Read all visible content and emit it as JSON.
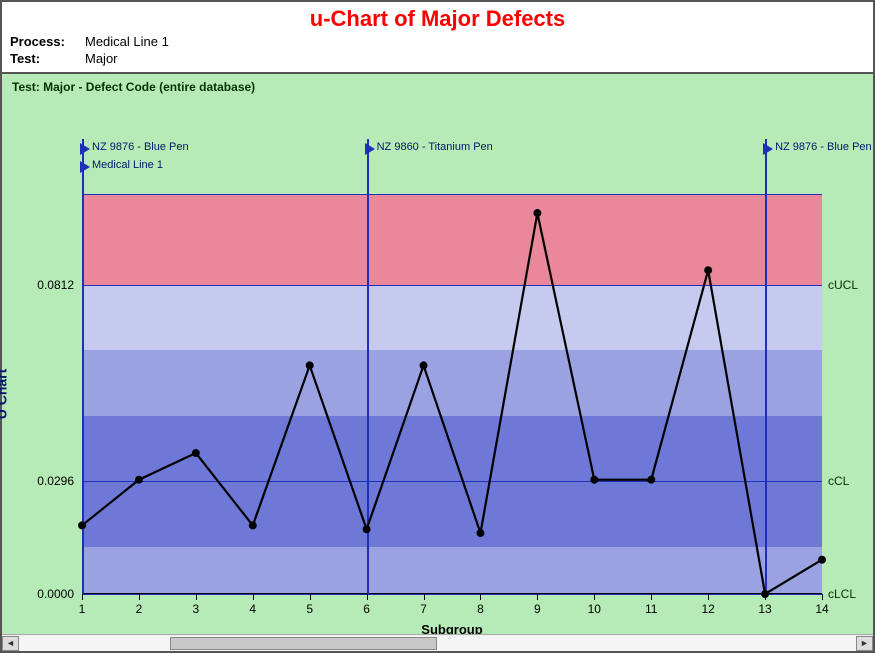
{
  "header": {
    "title": "u-Chart of Major Defects",
    "process_label": "Process:",
    "process_value": "Medical Line 1",
    "test_label": "Test:",
    "test_value": "Major"
  },
  "chart_subtitle": "Test: Major - Defect Code (entire database)",
  "y_axis_label": "U Chart",
  "x_axis_label": "Subgroup",
  "y_ticks": [
    {
      "v": 0.0,
      "label": "0.0000"
    },
    {
      "v": 0.0296,
      "label": "0.0296"
    },
    {
      "v": 0.0812,
      "label": "0.0812"
    }
  ],
  "control_lines": [
    {
      "v": 0.0,
      "label": "cLCL"
    },
    {
      "v": 0.0296,
      "label": "cCL"
    },
    {
      "v": 0.0812,
      "label": "cUCL"
    }
  ],
  "chart_data": {
    "type": "line",
    "title": "u-Chart of Major Defects",
    "xlabel": "Subgroup",
    "ylabel": "U Chart",
    "ylim": [
      0.0,
      0.105
    ],
    "xlim": [
      1,
      14
    ],
    "categories": [
      1,
      2,
      3,
      4,
      5,
      6,
      7,
      8,
      9,
      10,
      11,
      12,
      13,
      14
    ],
    "values": [
      0.018,
      0.03,
      0.037,
      0.018,
      0.06,
      0.017,
      0.06,
      0.016,
      0.1,
      0.03,
      0.03,
      0.085,
      0.0,
      0.009
    ],
    "ucl": 0.0812,
    "cl": 0.0296,
    "lcl": 0.0,
    "zone_top": 0.105,
    "sigma_width": 0.0172
  },
  "event_markers": [
    {
      "x": 1,
      "labels": [
        "NZ 9876 - Blue Pen",
        "Medical Line 1"
      ]
    },
    {
      "x": 6,
      "labels": [
        "NZ 9860 - Titanium Pen"
      ]
    },
    {
      "x": 13,
      "labels": [
        "NZ 9876 - Blue Pen"
      ]
    }
  ],
  "scrollbar": {
    "thumb_left_pct": 18,
    "thumb_width_pct": 32
  }
}
